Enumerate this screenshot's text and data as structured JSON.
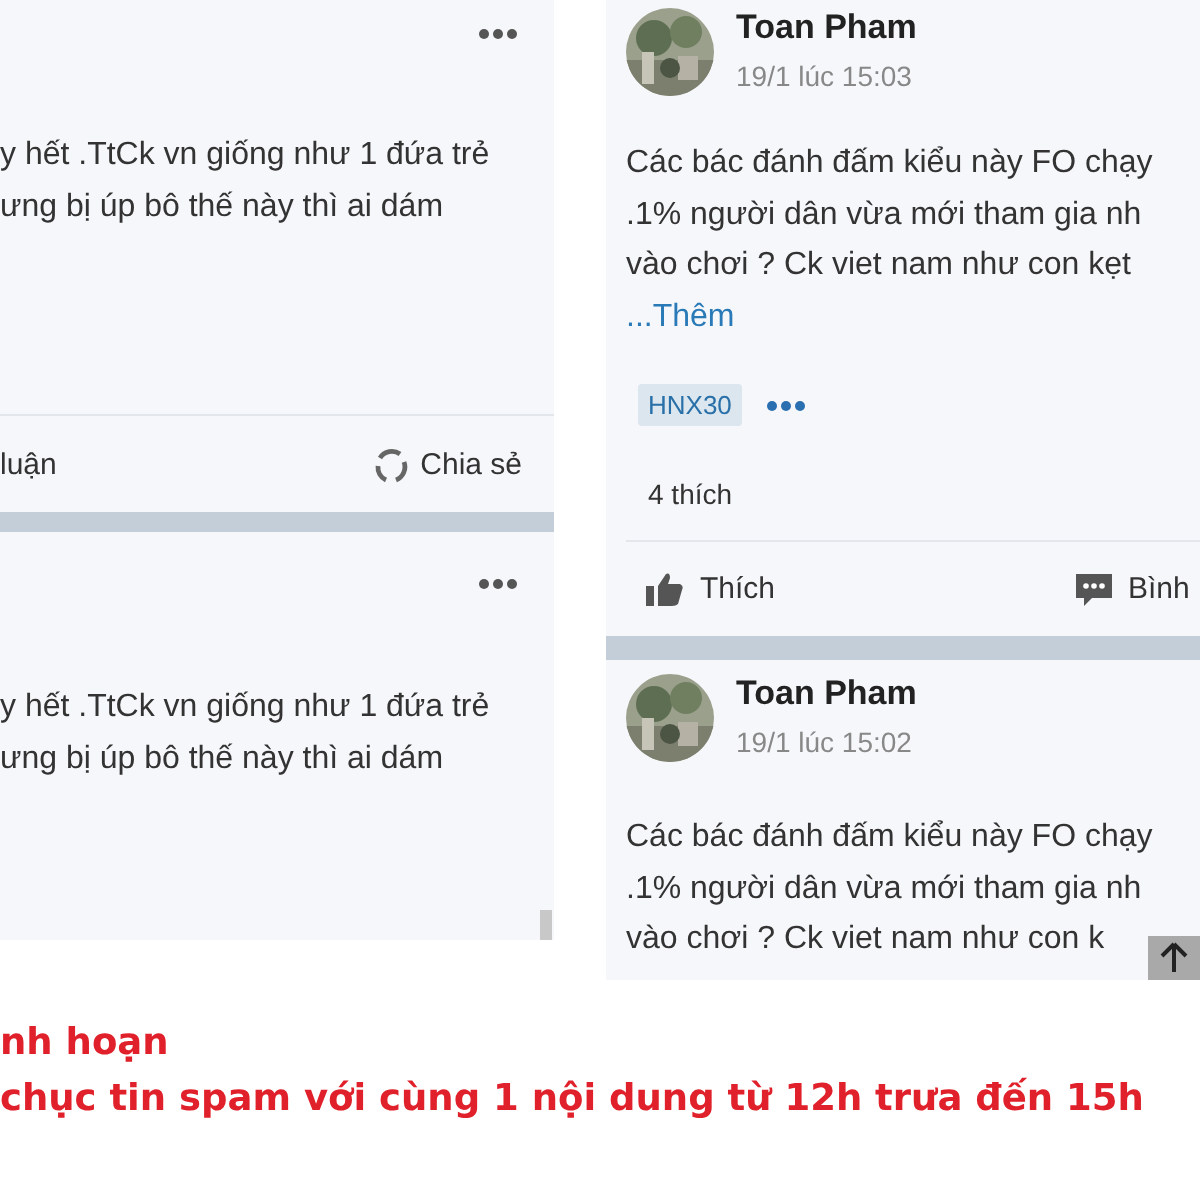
{
  "left_panel": {
    "posts": [
      {
        "lines": [
          "y hết .TtCk vn giống như 1 đứa trẻ",
          "ưng bị úp bô thế này thì ai dám"
        ],
        "footer": {
          "comment": "luận",
          "share": "Chia sẻ"
        }
      },
      {
        "lines": [
          "y hết .TtCk vn giống như 1 đứa trẻ",
          "ưng bị úp bô thế này thì ai dám"
        ]
      }
    ]
  },
  "right_panel": {
    "posts": [
      {
        "author": "Toan Pham",
        "time": "19/1 lúc 15:03",
        "lines": [
          "Các bác đánh đấm kiểu này FO chạy",
          ".1% người dân vừa mới tham gia nh",
          "vào chơi ? Ck viet nam như con kẹt"
        ],
        "more": "...Thêm",
        "tags": [
          "HNX30"
        ],
        "likes": "4 thích",
        "actions": {
          "like": "Thích",
          "comment": "Bình"
        }
      },
      {
        "author": "Toan Pham",
        "time": "19/1 lúc 15:02",
        "lines": [
          "Các bác đánh đấm kiểu này FO chạy",
          ".1% người dân vừa mới tham gia nh",
          "vào chơi ? Ck viet nam như con k"
        ]
      }
    ]
  },
  "caption": {
    "lines": [
      "nh hoạn",
      "chục tin spam với cùng 1 nội dung từ 12h trưa đến 15h"
    ]
  }
}
